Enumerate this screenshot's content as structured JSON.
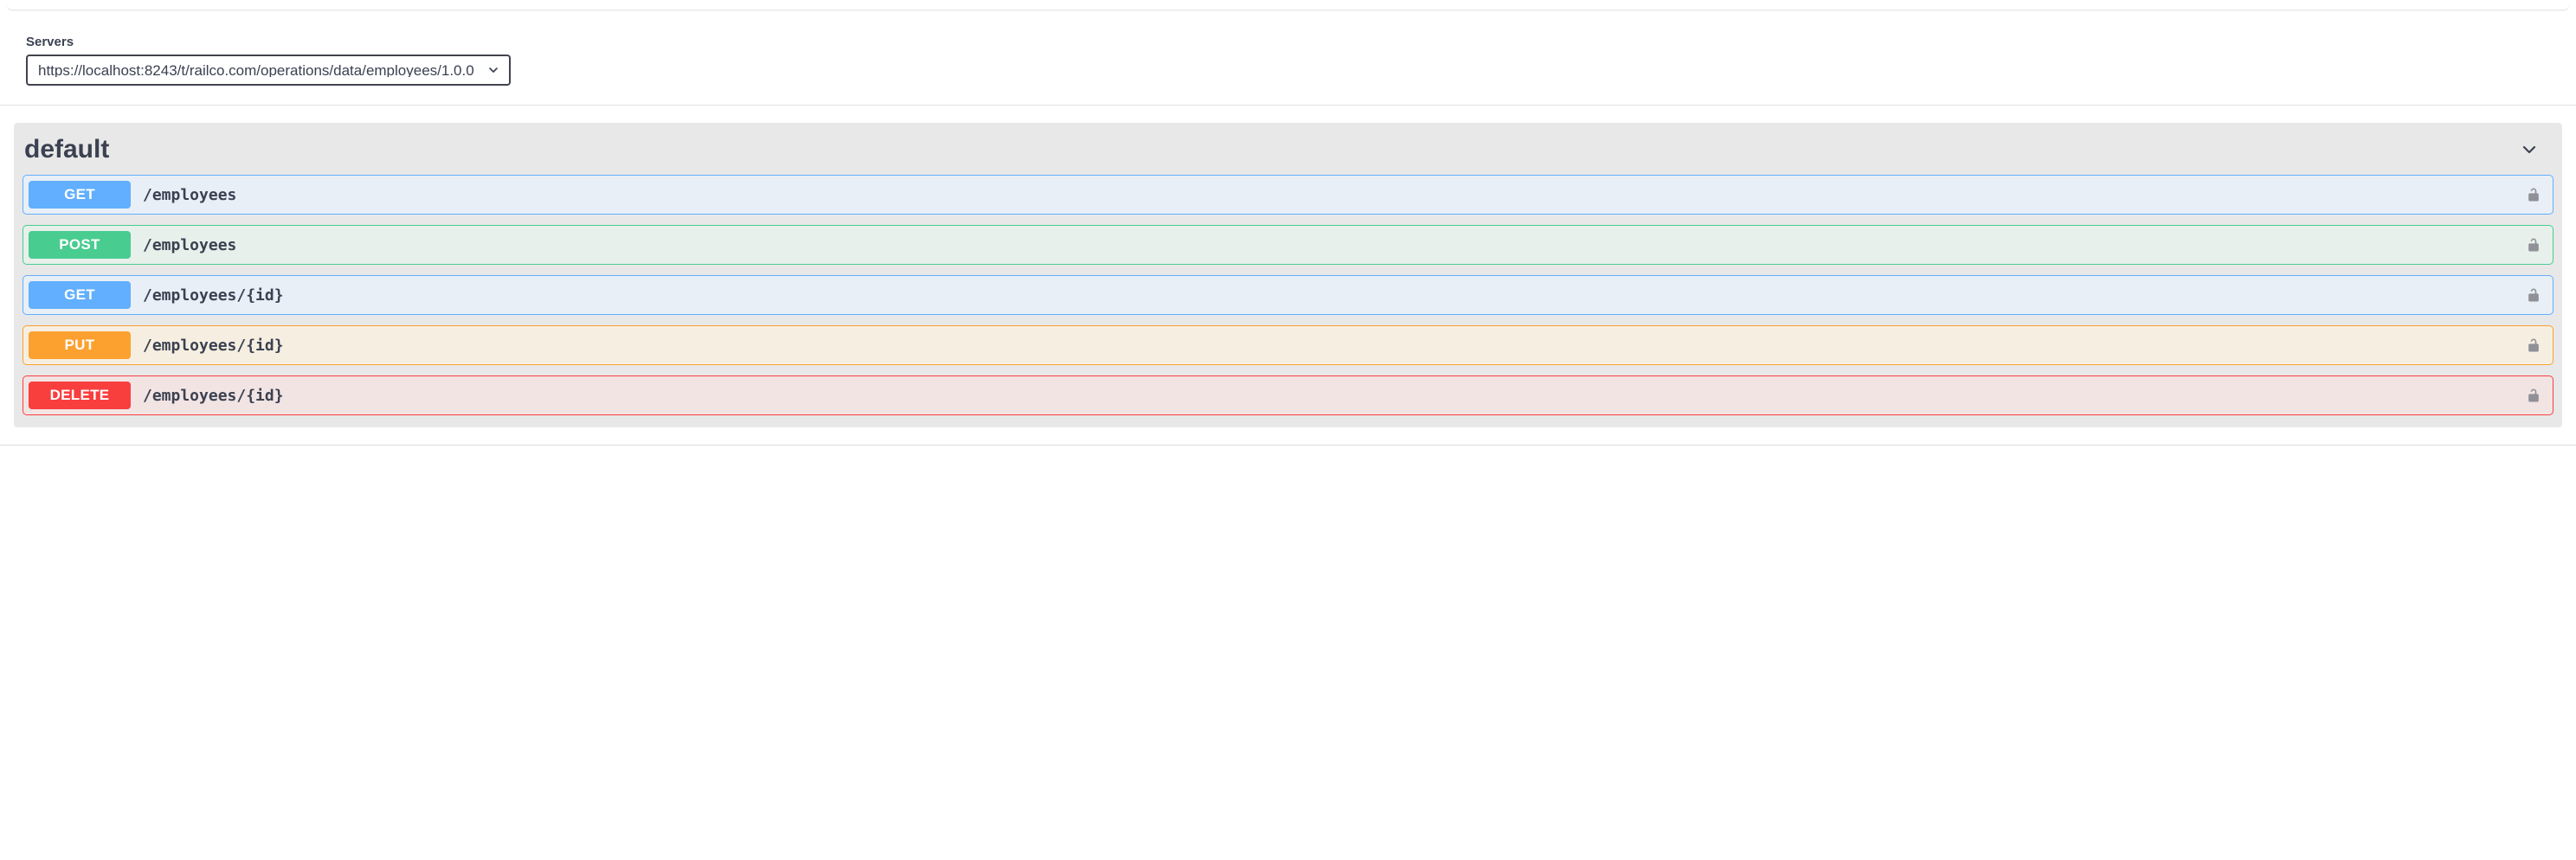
{
  "servers": {
    "label": "Servers",
    "selected": "https://localhost:8243/t/railco.com/operations/data/employees/1.0.0"
  },
  "tag": {
    "name": "default"
  },
  "operations": [
    {
      "method": "GET",
      "path": "/employees"
    },
    {
      "method": "POST",
      "path": "/employees"
    },
    {
      "method": "GET",
      "path": "/employees/{id}"
    },
    {
      "method": "PUT",
      "path": "/employees/{id}"
    },
    {
      "method": "DELETE",
      "path": "/employees/{id}"
    }
  ],
  "colors": {
    "get": "#61affe",
    "post": "#49cc90",
    "put": "#fca130",
    "delete": "#f93e3e"
  }
}
